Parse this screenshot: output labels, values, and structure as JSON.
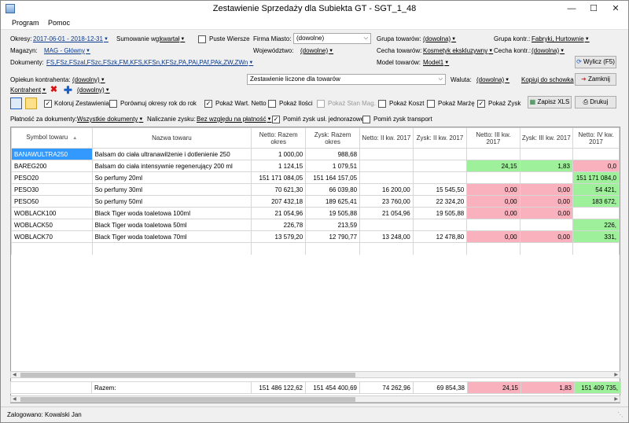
{
  "window": {
    "title": "Zestawienie Sprzedaży dla Subiekta GT - SGT_1_48"
  },
  "menu": [
    "Program",
    "Pomoc"
  ],
  "filters": {
    "okres_label": "Okresy:",
    "okres_value": "2017-06-01 - 2018-12-31",
    "sumowanie_label": "Sumowanie wg:",
    "sumowanie_value": "kwartał",
    "puste_wiersze": "Puste Wiersze",
    "firma_miasto_label": "Firma Miasto:",
    "firma_miasto_value": "(dowolne)",
    "grupa_towarow_label": "Grupa towarów:",
    "grupa_towarow_value": "(dowolna)",
    "grupa_kontr_label": "Grupa kontr.:",
    "grupa_kontr_value": "Fabryki, Hurtownie",
    "magazyn_label": "Magazyn:",
    "magazyn_value": "MAG - Główny",
    "wojewodztwo_label": "Województwo:",
    "wojewodztwo_value": "(dowolne)",
    "cecha_towarow_label": "Cecha towarów:",
    "cecha_towarow_value": "Kosmetyk ekskluzywny",
    "cecha_kontr_label": "Cecha kontr.:",
    "cecha_kontr_value": "(dowolna)",
    "dokumenty_label": "Dokumenty:",
    "dokumenty_value": "FS,FSz,FSzal,FSzc,FSzk,FM,KFS,KFSn,KFSz,PA,PAi,PAf,PAk,ZW,ZWn",
    "model_towarow_label": "Model towarów:",
    "model_towarow_value": "Model1",
    "opiekun_label": "Opiekun kontrahenta:",
    "opiekun_value": "(dowolny)",
    "zestawienie_value": "Zestawienie liczone dla towarów",
    "waluta_label": "Waluta:",
    "waluta_value": "(dowolna)",
    "kontrahent_label": "Kontrahent",
    "kontrahent_value": "(dowolny)"
  },
  "buttons": {
    "wylicz": "Wylicz (F5)",
    "kopiuj": "Kopiuj do schowka",
    "zamknij": "Zamknij",
    "zapisz_xls": "Zapisz XLS",
    "drukuj": "Drukuj"
  },
  "options": {
    "koloruj": "Koloruj Zestawienia",
    "porownaj": "Porównuj okresy rok do rok",
    "pokaz_wart_netto": "Pokaż Wart. Netto",
    "pokaz_ilosci": "Pokaż Ilości",
    "pokaz_stan_mag": "Pokaż Stan Mag.",
    "pokaz_koszt": "Pokaż Koszt",
    "pokaz_marze": "Pokaż Marżę",
    "pokaz_zysk": "Pokaż Zysk",
    "platnosc_label": "Płatność za dokumenty:",
    "platnosc_value": "Wszystkie dokumenty",
    "naliczanie_label": "Naliczanie zysku:",
    "naliczanie_value": "Bez względu na płatność",
    "pomin_usl": "Pomiń zysk usł. jednorazowe",
    "pomin_transport": "Pomiń zysk transport"
  },
  "table": {
    "headers": [
      "Symbol towaru",
      "Nazwa towaru",
      "Netto: Razem okres",
      "Zysk: Razem okres",
      "Netto: II kw. 2017",
      "Zysk: II kw. 2017",
      "Netto: III kw. 2017",
      "Zysk: III kw. 2017",
      "Netto: IV kw. 2017"
    ],
    "rows": [
      {
        "symbol": "BANAWULTRA250",
        "nazwa": "Balsam do ciała ultranawilżenie i dotlenienie 250",
        "c": [
          "1 000,00",
          "988,68",
          "",
          "",
          "",
          "",
          ""
        ],
        "k": [
          "",
          "",
          "",
          "",
          "w",
          "w",
          "w"
        ]
      },
      {
        "symbol": "BAREG200",
        "nazwa": "Balsam do ciała intensywnie regenerujący 200 ml",
        "c": [
          "1 124,15",
          "1 079,51",
          "",
          "",
          "24,15",
          "1,83",
          "0,0"
        ],
        "k": [
          "",
          "",
          "",
          "",
          "pos",
          "pos",
          "neg"
        ]
      },
      {
        "symbol": "PESO20",
        "nazwa": "So perfumy 20ml",
        "c": [
          "151 171 084,05",
          "151 164 157,05",
          "",
          "",
          "",
          "",
          "151 171 084,0"
        ],
        "k": [
          "",
          "",
          "",
          "",
          "w",
          "w",
          "pos"
        ]
      },
      {
        "symbol": "PESO30",
        "nazwa": "So perfumy 30ml",
        "c": [
          "70 621,30",
          "66 039,80",
          "16 200,00",
          "15 545,50",
          "0,00",
          "0,00",
          "54 421,"
        ],
        "k": [
          "",
          "",
          "",
          "",
          "neg",
          "neg",
          "pos"
        ]
      },
      {
        "symbol": "PESO50",
        "nazwa": "So perfumy 50ml",
        "c": [
          "207 432,18",
          "189 625,41",
          "23 760,00",
          "22 324,20",
          "0,00",
          "0,00",
          "183 672,"
        ],
        "k": [
          "",
          "",
          "",
          "",
          "neg",
          "neg",
          "pos"
        ]
      },
      {
        "symbol": "WOBLACK100",
        "nazwa": "Black Tiger woda toaletowa 100ml",
        "c": [
          "21 054,96",
          "19 505,88",
          "21 054,96",
          "19 505,88",
          "0,00",
          "0,00",
          ""
        ],
        "k": [
          "",
          "",
          "",
          "",
          "neg",
          "neg",
          "w"
        ]
      },
      {
        "symbol": "WOBLACK50",
        "nazwa": "Black Tiger woda toaletowa 50ml",
        "c": [
          "226,78",
          "213,59",
          "",
          "",
          "",
          "",
          "226,"
        ],
        "k": [
          "",
          "",
          "",
          "",
          "w",
          "w",
          "pos"
        ]
      },
      {
        "symbol": "WOBLACK70",
        "nazwa": "Black Tiger woda toaletowa 70ml",
        "c": [
          "13 579,20",
          "12 790,77",
          "13 248,00",
          "12 478,80",
          "0,00",
          "0,00",
          "331,"
        ],
        "k": [
          "",
          "",
          "",
          "",
          "neg",
          "neg",
          "pos"
        ]
      }
    ],
    "totals": {
      "label": "Razem:",
      "c": [
        "151 486 122,62",
        "151 454 400,69",
        "74 262,96",
        "69 854,38",
        "24,15",
        "1,83",
        "151 409 735,"
      ],
      "k": [
        "",
        "",
        "",
        "",
        "neg",
        "neg",
        "pos"
      ]
    }
  },
  "status": {
    "text": "Zalogowano: Kowalski Jan"
  },
  "colors": {
    "positive": "#9ff09b",
    "negative": "#f9b1be",
    "selected": "#3399ff"
  }
}
